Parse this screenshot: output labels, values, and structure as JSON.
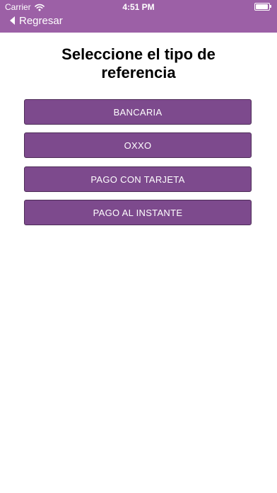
{
  "status_bar": {
    "carrier": "Carrier",
    "time": "4:51 PM"
  },
  "nav": {
    "back_label": "Regresar"
  },
  "page": {
    "title_line1": "Seleccione el tipo de",
    "title_line2": "referencia"
  },
  "options": [
    {
      "label": "BANCARIA"
    },
    {
      "label": "OXXO"
    },
    {
      "label": "PAGO CON TARJETA"
    },
    {
      "label": "PAGO AL INSTANTE"
    }
  ],
  "colors": {
    "header": "#9c60a6",
    "button": "#7d4a8d",
    "button_border": "#4d2d57"
  },
  "icons": {
    "back": "chevron-left-icon",
    "wifi": "wifi-icon",
    "battery": "battery-icon"
  }
}
